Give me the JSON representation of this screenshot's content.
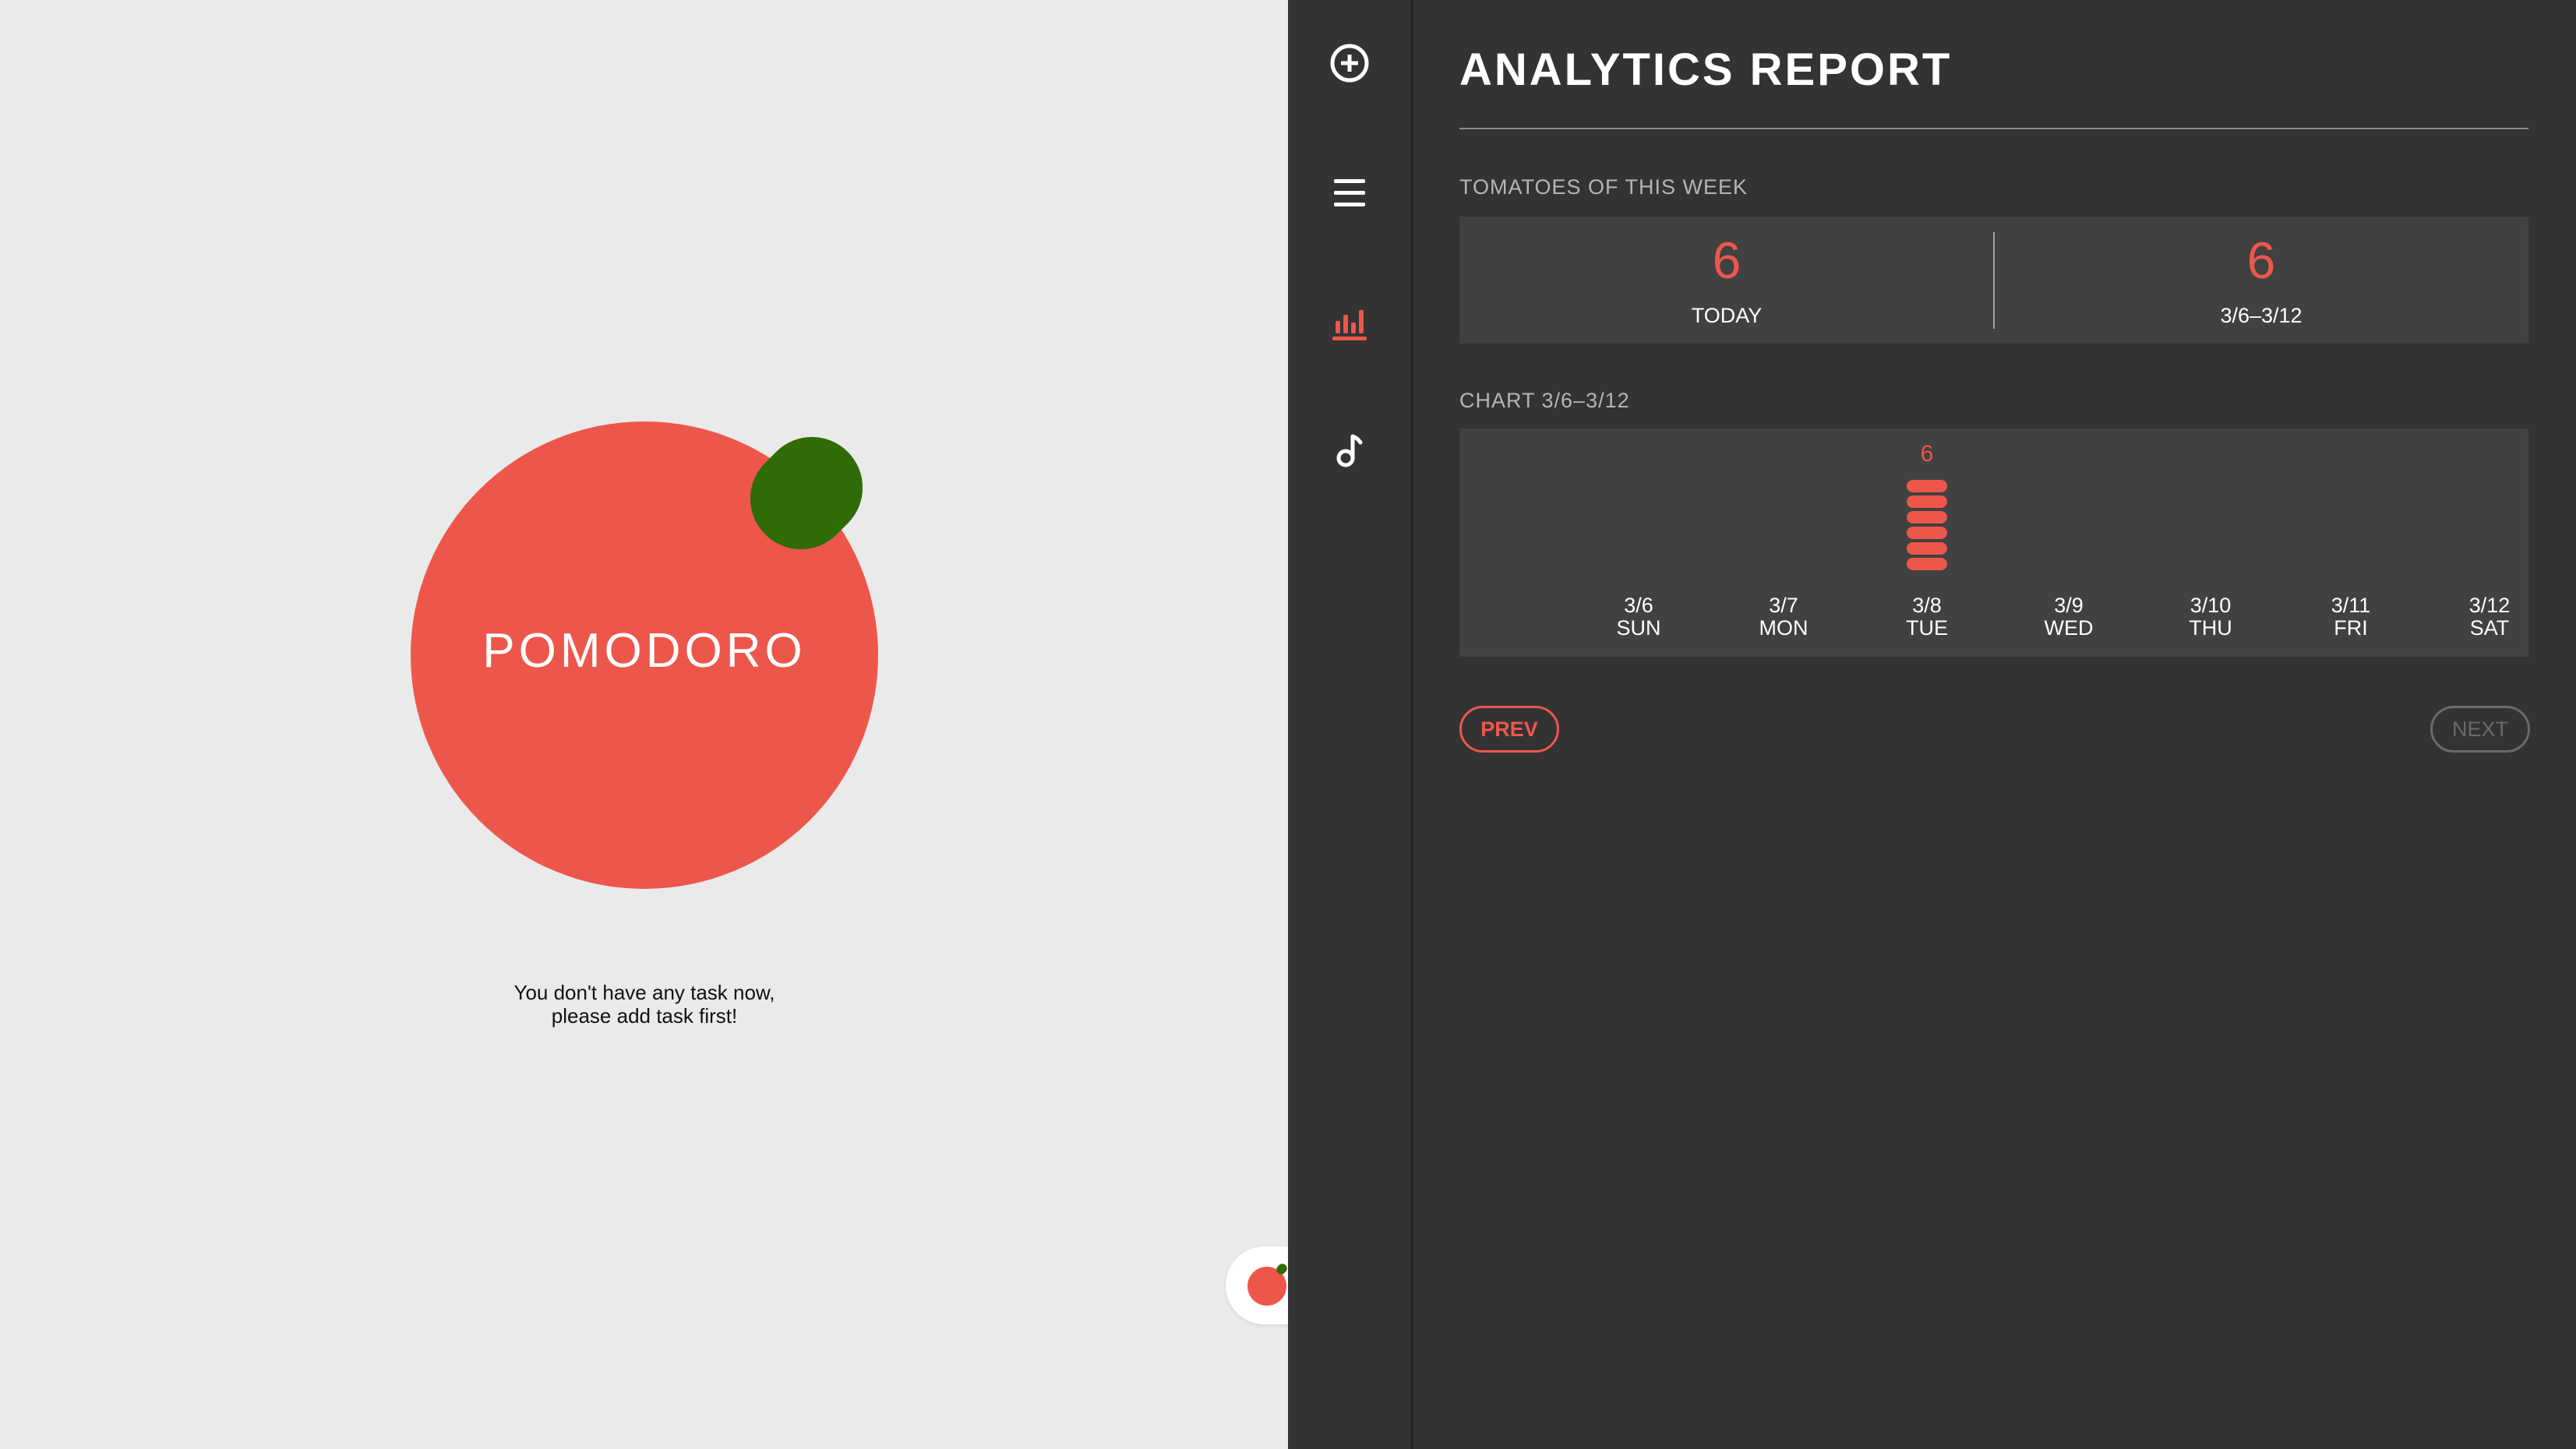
{
  "pomodoro": {
    "label": "POMODORO",
    "message_line1": "You don't have any task now,",
    "message_line2": "please add task first!"
  },
  "sidebar": {
    "items": [
      {
        "icon": "add-circle-icon",
        "active": false
      },
      {
        "icon": "menu-icon",
        "active": false
      },
      {
        "icon": "bar-chart-icon",
        "active": true
      },
      {
        "icon": "music-note-icon",
        "active": false
      }
    ]
  },
  "report": {
    "title": "ANALYTICS REPORT",
    "week_section_label": "TOMATOES OF THIS WEEK",
    "today_count": "6",
    "today_label": "TODAY",
    "week_count": "6",
    "week_range": "3/6–3/12",
    "chart_section_label": "CHART 3/6–3/12",
    "prev_label": "PREV",
    "next_label": "NEXT"
  },
  "chart_data": {
    "type": "bar",
    "title": "CHART 3/6–3/12",
    "categories": [
      "3/6 SUN",
      "3/7 MON",
      "3/8 TUE",
      "3/9 WED",
      "3/10 THU",
      "3/11 FRI",
      "3/12 SAT"
    ],
    "dates": [
      "3/6",
      "3/7",
      "3/8",
      "3/9",
      "3/10",
      "3/11",
      "3/12"
    ],
    "weekdays": [
      "SUN",
      "MON",
      "TUE",
      "WED",
      "THU",
      "FRI",
      "SAT"
    ],
    "values": [
      0,
      0,
      6,
      0,
      0,
      0,
      0
    ],
    "value_labels": [
      "",
      "",
      "6",
      "",
      "",
      "",
      ""
    ]
  },
  "colors": {
    "accent": "#ed574b",
    "stem": "#2f6b06",
    "panel": "#333333",
    "card": "#414141",
    "left_bg": "#eaeaea"
  }
}
